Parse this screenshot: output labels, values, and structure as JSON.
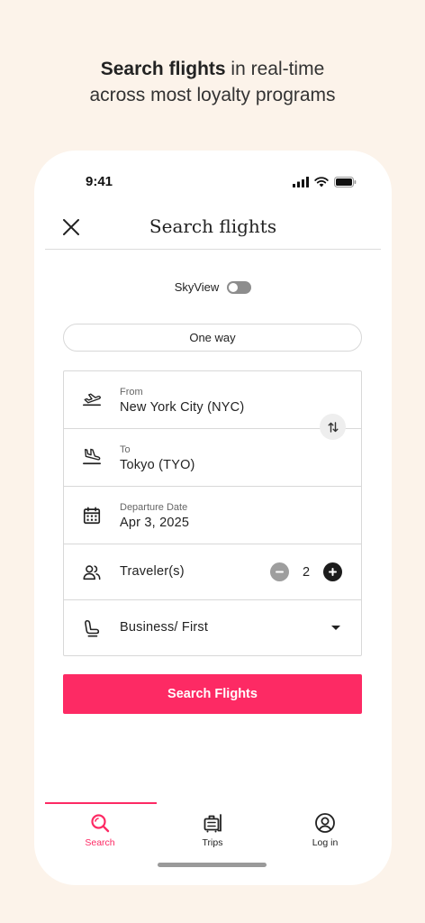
{
  "headline": {
    "bold": "Search flights",
    "rest": " in real-time",
    "line2": "across  most loyalty programs"
  },
  "status": {
    "time": "9:41"
  },
  "header": {
    "title": "Search flights"
  },
  "skyview": {
    "label": "SkyView",
    "enabled": false
  },
  "trip_type": {
    "selected": "One way"
  },
  "form": {
    "from": {
      "label": "From",
      "value": "New York City (NYC)"
    },
    "to": {
      "label": "To",
      "value": "Tokyo (TYO)"
    },
    "date": {
      "label": "Departure Date",
      "value": "Apr 3, 2025"
    },
    "travelers": {
      "label": "Traveler(s)",
      "count": "2"
    },
    "cabin": {
      "value": "Business/ First"
    }
  },
  "search_button": {
    "label": "Search Flights"
  },
  "tabs": [
    {
      "label": "Search",
      "icon": "search-icon",
      "active": true
    },
    {
      "label": "Trips",
      "icon": "luggage-icon",
      "active": false
    },
    {
      "label": "Log in",
      "icon": "account-icon",
      "active": false
    }
  ],
  "colors": {
    "accent": "#fd2a64",
    "background": "#fcf3ea"
  }
}
